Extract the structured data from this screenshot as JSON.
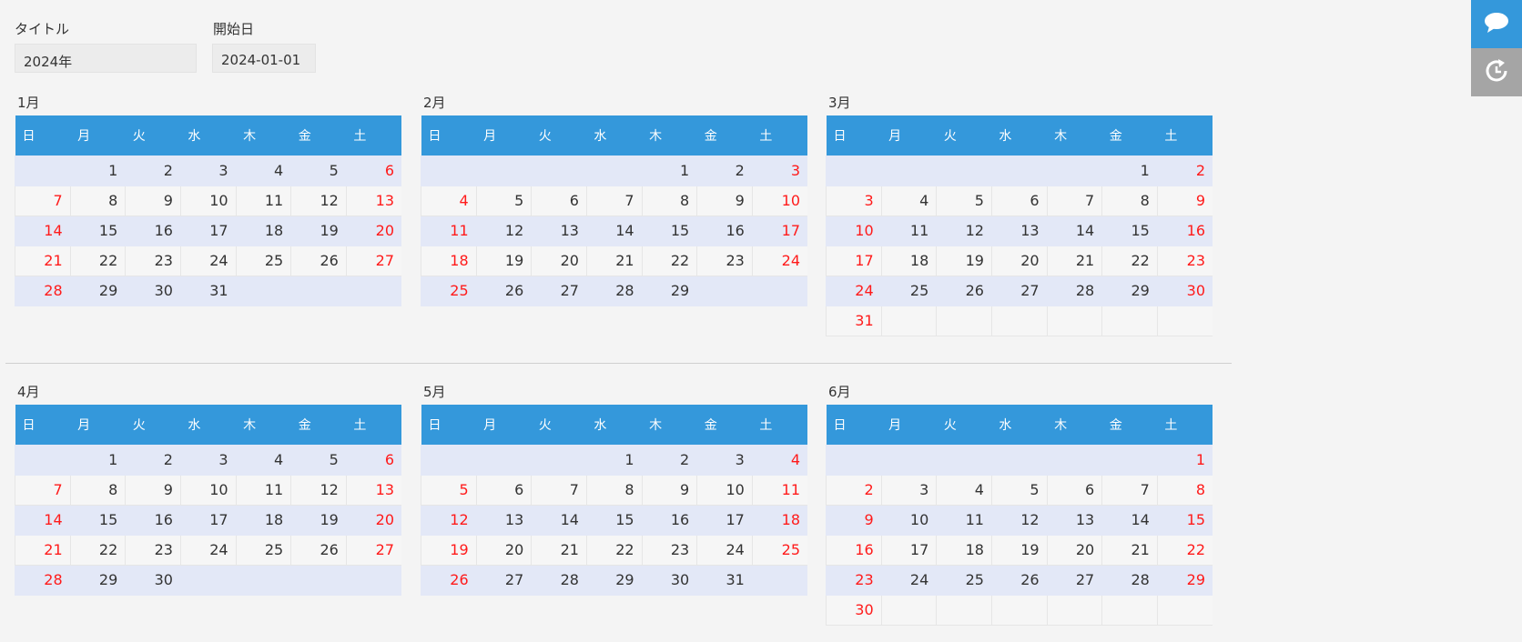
{
  "fields": {
    "title_label": "タイトル",
    "title_value": "2024年",
    "start_label": "開始日",
    "start_value": "2024-01-01"
  },
  "weekdays": [
    "日",
    "月",
    "火",
    "水",
    "木",
    "金",
    "土"
  ],
  "months": [
    {
      "label": "1月",
      "weeks": [
        [
          "",
          "1",
          "2",
          "3",
          "4",
          "5",
          "6"
        ],
        [
          "7",
          "8",
          "9",
          "10",
          "11",
          "12",
          "13"
        ],
        [
          "14",
          "15",
          "16",
          "17",
          "18",
          "19",
          "20"
        ],
        [
          "21",
          "22",
          "23",
          "24",
          "25",
          "26",
          "27"
        ],
        [
          "28",
          "29",
          "30",
          "31",
          "",
          "",
          ""
        ]
      ]
    },
    {
      "label": "2月",
      "weeks": [
        [
          "",
          "",
          "",
          "",
          "1",
          "2",
          "3"
        ],
        [
          "4",
          "5",
          "6",
          "7",
          "8",
          "9",
          "10"
        ],
        [
          "11",
          "12",
          "13",
          "14",
          "15",
          "16",
          "17"
        ],
        [
          "18",
          "19",
          "20",
          "21",
          "22",
          "23",
          "24"
        ],
        [
          "25",
          "26",
          "27",
          "28",
          "29",
          "",
          ""
        ]
      ]
    },
    {
      "label": "3月",
      "weeks": [
        [
          "",
          "",
          "",
          "",
          "",
          "1",
          "2"
        ],
        [
          "3",
          "4",
          "5",
          "6",
          "7",
          "8",
          "9"
        ],
        [
          "10",
          "11",
          "12",
          "13",
          "14",
          "15",
          "16"
        ],
        [
          "17",
          "18",
          "19",
          "20",
          "21",
          "22",
          "23"
        ],
        [
          "24",
          "25",
          "26",
          "27",
          "28",
          "29",
          "30"
        ],
        [
          "31",
          "",
          "",
          "",
          "",
          "",
          ""
        ]
      ]
    },
    {
      "label": "4月",
      "weeks": [
        [
          "",
          "1",
          "2",
          "3",
          "4",
          "5",
          "6"
        ],
        [
          "7",
          "8",
          "9",
          "10",
          "11",
          "12",
          "13"
        ],
        [
          "14",
          "15",
          "16",
          "17",
          "18",
          "19",
          "20"
        ],
        [
          "21",
          "22",
          "23",
          "24",
          "25",
          "26",
          "27"
        ],
        [
          "28",
          "29",
          "30",
          "",
          "",
          "",
          ""
        ]
      ]
    },
    {
      "label": "5月",
      "weeks": [
        [
          "",
          "",
          "",
          "1",
          "2",
          "3",
          "4"
        ],
        [
          "5",
          "6",
          "7",
          "8",
          "9",
          "10",
          "11"
        ],
        [
          "12",
          "13",
          "14",
          "15",
          "16",
          "17",
          "18"
        ],
        [
          "19",
          "20",
          "21",
          "22",
          "23",
          "24",
          "25"
        ],
        [
          "26",
          "27",
          "28",
          "29",
          "30",
          "31",
          ""
        ]
      ]
    },
    {
      "label": "6月",
      "weeks": [
        [
          "",
          "",
          "",
          "",
          "",
          "",
          "1"
        ],
        [
          "2",
          "3",
          "4",
          "5",
          "6",
          "7",
          "8"
        ],
        [
          "9",
          "10",
          "11",
          "12",
          "13",
          "14",
          "15"
        ],
        [
          "16",
          "17",
          "18",
          "19",
          "20",
          "21",
          "22"
        ],
        [
          "23",
          "24",
          "25",
          "26",
          "27",
          "28",
          "29"
        ],
        [
          "30",
          "",
          "",
          "",
          "",
          "",
          ""
        ]
      ]
    }
  ],
  "side_buttons": [
    {
      "icon": "chat-bubble-icon"
    },
    {
      "icon": "refresh-icon"
    }
  ],
  "colors": {
    "header_blue": "#3498db",
    "holiday_red": "#ff1a1a",
    "odd_row": "#e3e8f7",
    "even_row": "#f6f6f6",
    "side_refresh_gray": "#a5a5a5"
  }
}
